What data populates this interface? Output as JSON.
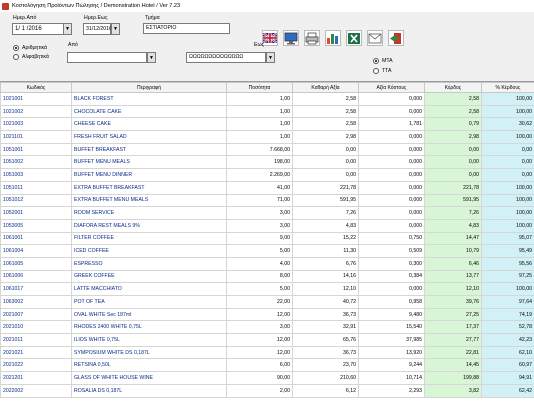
{
  "window": {
    "title": "Κοστολόγηση Προϊόντων Πώλησης  / Demonstration Hotel   / Ver 7.23"
  },
  "filters": {
    "date_from_label": "Ημερ.Από",
    "date_from_value": "1/ 1 /2016",
    "date_to_label": "Ημερ.Εως",
    "date_to_value": "31/12/2016",
    "sector_label": "Τμήμα",
    "sector_value": "ΕΣΤΙΑΤΟΡΙΟ",
    "from_label": "Από",
    "to_label": "Εως",
    "to_value": "ΩΩΩΩΩΩΩΩΩΩΩΩΩΩ",
    "sort_numeric": "Αριθμητικά",
    "sort_alpha": "Αλφαβητικά",
    "mode_a": "ΜΤΑ",
    "mode_b": "ΤΤΑ"
  },
  "columns": [
    "Κωδικός",
    "Περιγραφή",
    "Ποσότητα",
    "Καθαρή Αξία",
    "Αξία Κόστους",
    "Κέρδος",
    "% Κέρδους"
  ],
  "rows": [
    [
      "1021001",
      "BLACK FOREST",
      "1,00",
      "2,58",
      "0,000",
      "2,58",
      "100,00"
    ],
    [
      "1021002",
      "CHOCOLATE CAKE",
      "1,00",
      "2,58",
      "0,000",
      "2,58",
      "100,00"
    ],
    [
      "1021003",
      "CHEESE CAKE",
      "1,00",
      "2,58",
      "1,781",
      "0,79",
      "30,62"
    ],
    [
      "1021101",
      "FRESH FRUIT SALAD",
      "1,00",
      "2,98",
      "0,000",
      "2,98",
      "100,00"
    ],
    [
      "1051001",
      "BUFFET BREAKFAST",
      "7.668,00",
      "0,00",
      "0,000",
      "0,00",
      "0,00"
    ],
    [
      "1051002",
      "BUFFET MENU MEALS",
      "198,00",
      "0,00",
      "0,000",
      "0,00",
      "0,00"
    ],
    [
      "1051003",
      "BUFFET MENU DINNER",
      "2.269,00",
      "0,00",
      "0,000",
      "0,00",
      "0,00"
    ],
    [
      "1051011",
      "EXTRA BUFFET BREAKFAST",
      "41,00",
      "221,78",
      "0,000",
      "221,78",
      "100,00"
    ],
    [
      "1051012",
      "EXTRA BUFFET MENU MEALS",
      "71,00",
      "591,95",
      "0,000",
      "591,95",
      "100,00"
    ],
    [
      "1052001",
      "ROOM SERVICE",
      "3,00",
      "7,26",
      "0,000",
      "7,26",
      "100,00"
    ],
    [
      "1053005",
      "DIAFORA REST MEALS 9%",
      "3,00",
      "4,83",
      "0,000",
      "4,83",
      "100,00"
    ],
    [
      "1061001",
      "FILTER COFFEE",
      "9,00",
      "15,22",
      "0,750",
      "14,47",
      "95,07"
    ],
    [
      "1061004",
      "ICED COFFEE",
      "5,00",
      "11,30",
      "0,509",
      "10,79",
      "95,49"
    ],
    [
      "1061005",
      "ESPRESSO",
      "4,00",
      "6,76",
      "0,300",
      "6,46",
      "95,56"
    ],
    [
      "1061006",
      "GREEK COFFEE",
      "8,00",
      "14,16",
      "0,384",
      "13,77",
      "97,25"
    ],
    [
      "1061017",
      "LATTE MACCHIATO",
      "5,00",
      "12,10",
      "0,000",
      "12,10",
      "100,00"
    ],
    [
      "1063002",
      "POT OF TEA",
      "22,00",
      "40,72",
      "0,958",
      "39,76",
      "97,64"
    ],
    [
      "2021007",
      "OVAL WHITE Sec 187ml",
      "12,00",
      "36,73",
      "9,480",
      "27,25",
      "74,19"
    ],
    [
      "2021010",
      "RHODES 2400 WHITE 0,75L",
      "3,00",
      "32,91",
      "15,540",
      "17,37",
      "52,78"
    ],
    [
      "2021011",
      "ILIOS WHITE 0,75L",
      "12,00",
      "65,76",
      "37,985",
      "27,77",
      "42,23"
    ],
    [
      "2021021",
      "SYMPOSIUM WHITE DS 0,187L",
      "12,00",
      "36,73",
      "13,920",
      "22,81",
      "62,10"
    ],
    [
      "2021022",
      "RETSINA 0,50L",
      "6,00",
      "23,70",
      "9,244",
      "14,45",
      "60,97"
    ],
    [
      "2021201",
      "GLASS OF WHITE HOUSE WINE",
      "90,00",
      "210,60",
      "10,714",
      "199,88",
      "94,91"
    ],
    [
      "2022002",
      "ROSALIA DS 0,187L",
      "2,00",
      "6,12",
      "2,293",
      "3,82",
      "62,42"
    ]
  ]
}
